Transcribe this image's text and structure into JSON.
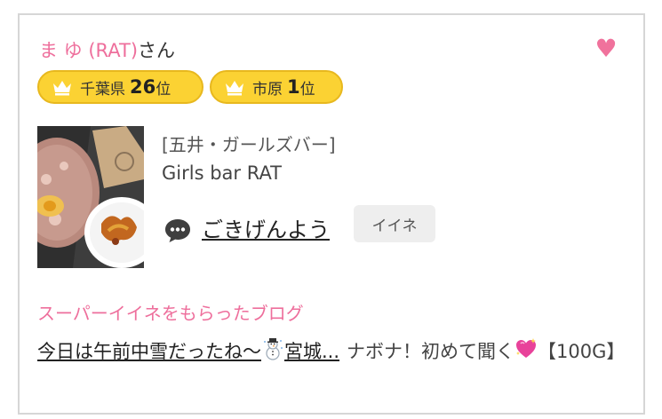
{
  "user": {
    "name": "ま ゆ (RAT)",
    "suffix": "さん",
    "favorite_icon": "heart-icon"
  },
  "badges": [
    {
      "area": "千葉県",
      "rank": "26",
      "unit": "位",
      "icon": "crown-icon"
    },
    {
      "area": "市原",
      "rank": "1",
      "unit": "位",
      "icon": "crown-icon"
    }
  ],
  "shop": {
    "genre": "[五井・ガールズバー]",
    "name": "Girls bar RAT"
  },
  "greeting": {
    "icon": "speech-bubble-icon",
    "text": "ごきげんよう",
    "button_label": "イイネ"
  },
  "blogs": {
    "section_title": "スーパーイイネをもらったブログ",
    "items": [
      {
        "title_before": "今日は午前中雪だったね〜",
        "emoji": "snowman-icon",
        "title_after": "宮城..."
      },
      {
        "title_before": "ナボナ！初めて聞く",
        "emoji": "sparkling-heart-icon",
        "title_after": "【100G】"
      }
    ]
  },
  "colors": {
    "accent_pink": "#ee6f9c",
    "badge_yellow": "#fbd233",
    "button_gray": "#eeeeee"
  }
}
